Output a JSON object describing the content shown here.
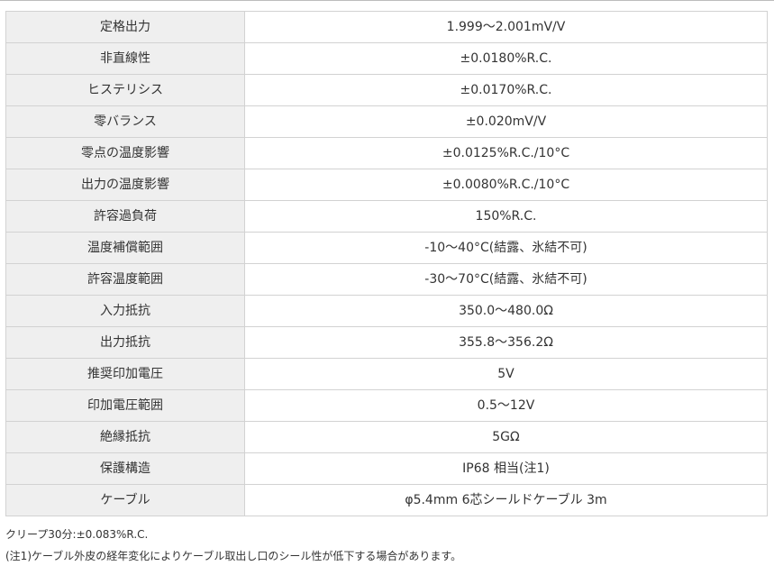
{
  "spec_table": {
    "rows": [
      {
        "label": "定格出力",
        "value": "1.999〜2.001mV/V"
      },
      {
        "label": "非直線性",
        "value": "±0.0180%R.C."
      },
      {
        "label": "ヒステリシス",
        "value": "±0.0170%R.C."
      },
      {
        "label": "零バランス",
        "value": "±0.020mV/V"
      },
      {
        "label": "零点の温度影響",
        "value": "±0.0125%R.C./10°C"
      },
      {
        "label": "出力の温度影響",
        "value": "±0.0080%R.C./10°C"
      },
      {
        "label": "許容過負荷",
        "value": "150%R.C."
      },
      {
        "label": "温度補償範囲",
        "value": "-10〜40°C(結露、氷結不可)"
      },
      {
        "label": "許容温度範囲",
        "value": "-30〜70°C(結露、氷結不可)"
      },
      {
        "label": "入力抵抗",
        "value": "350.0〜480.0Ω"
      },
      {
        "label": "出力抵抗",
        "value": "355.8〜356.2Ω"
      },
      {
        "label": "推奨印加電圧",
        "value": "5V"
      },
      {
        "label": "印加電圧範囲",
        "value": "0.5〜12V"
      },
      {
        "label": "絶縁抵抗",
        "value": "5GΩ"
      },
      {
        "label": "保護構造",
        "value": "IP68 相当(注1)"
      },
      {
        "label": "ケーブル",
        "value": "φ5.4mm 6芯シールドケーブル 3m"
      }
    ]
  },
  "notes": {
    "creep": "クリープ30分:±0.083%R.C.",
    "note1": "(注1)ケーブル外皮の経年変化によりケーブル取出し口のシール性が低下する場合があります。"
  }
}
